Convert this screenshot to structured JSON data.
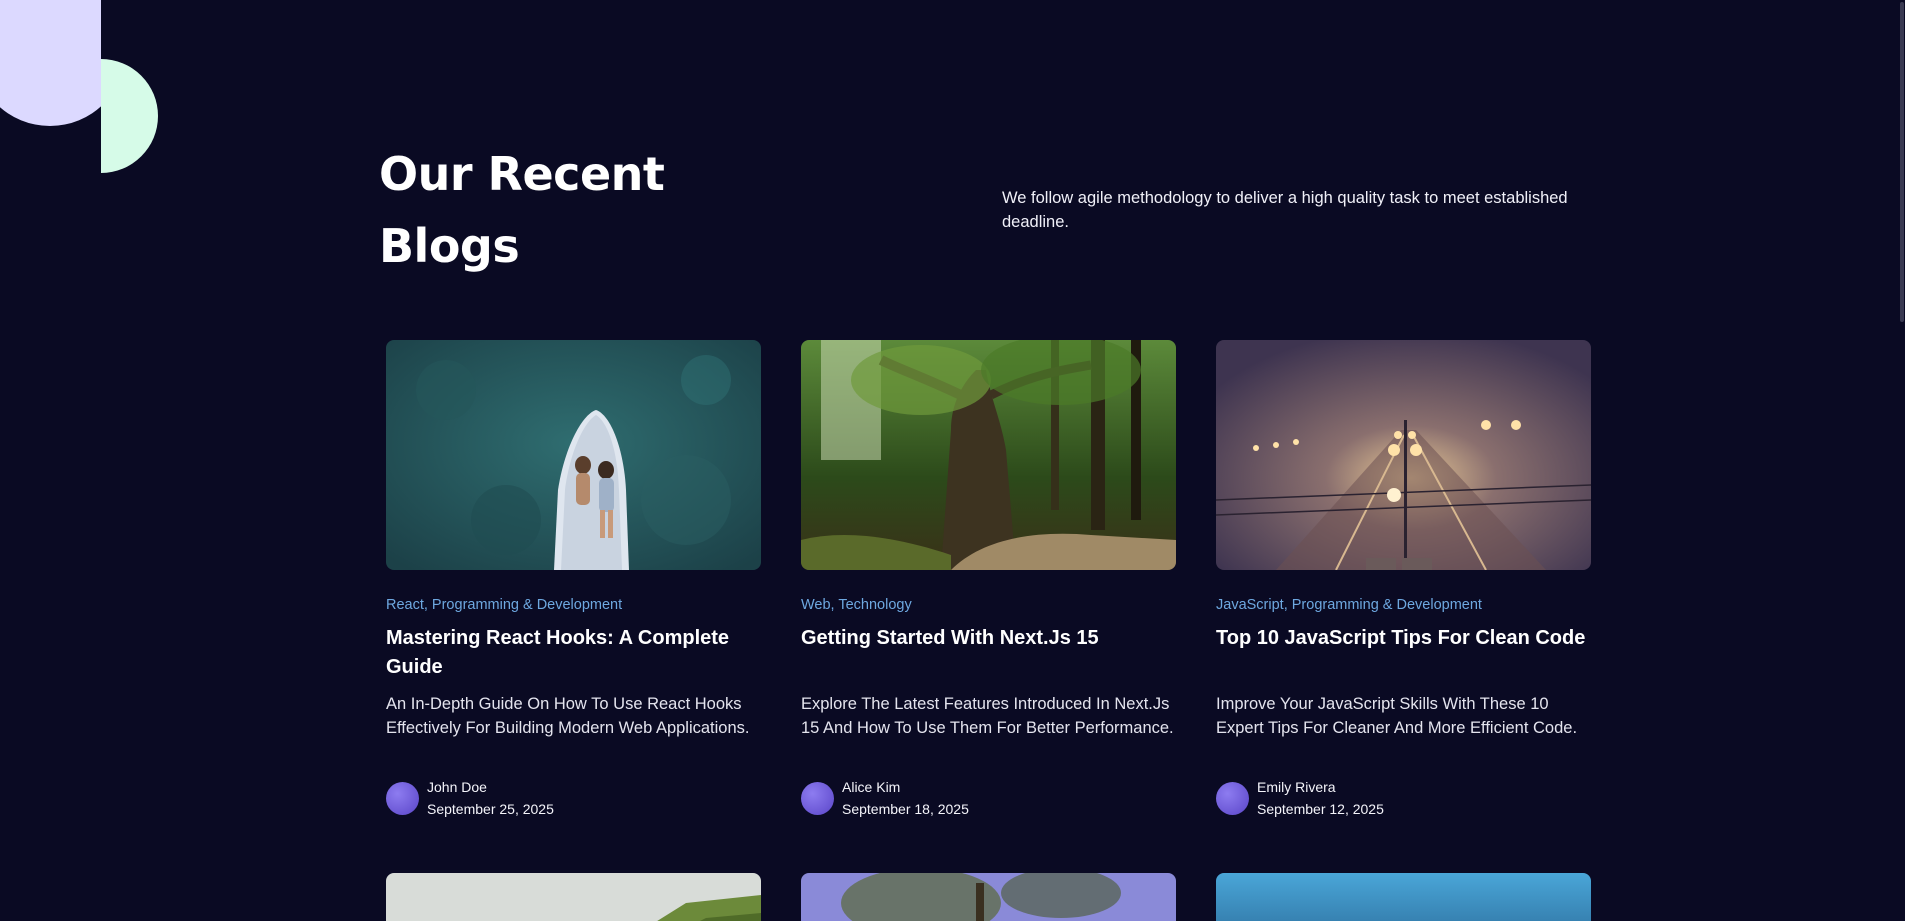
{
  "section": {
    "title": "Our Recent Blogs",
    "intro": "We follow agile methodology to deliver a high quality task to meet established deadline."
  },
  "posts": [
    {
      "categories": "React, Programming & Development",
      "title": "Mastering React Hooks: A Complete Guide",
      "description": "An In-Depth Guide On How To Use React Hooks Effectively For Building Modern Web Applications.",
      "author": "John Doe",
      "date": "September 25, 2025",
      "image_icon": "boat-aerial-image"
    },
    {
      "categories": "Web, Technology",
      "title": "Getting Started With Next.Js 15",
      "description": "Explore The Latest Features Introduced In Next.Js 15 And How To Use Them For Better Performance.",
      "author": "Alice Kim",
      "date": "September 18, 2025",
      "image_icon": "forest-path-image"
    },
    {
      "categories": "JavaScript, Programming & Development",
      "title": "Top 10 JavaScript Tips For Clean Code",
      "description": "Improve Your JavaScript Skills With These 10 Expert Tips For Cleaner And More Efficient Code.",
      "author": "Emily Rivera",
      "date": "September 12, 2025",
      "image_icon": "foggy-railway-image"
    }
  ],
  "colors": {
    "background": "#0a0a23",
    "category": "#6ea8e0",
    "deco_lavender": "#dcd9ff",
    "deco_mint": "#d6fbe8",
    "avatar": "#7060dc"
  }
}
